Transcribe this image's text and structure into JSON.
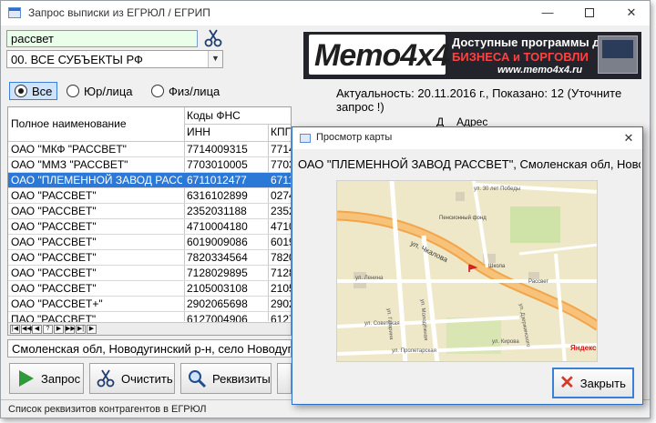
{
  "window": {
    "title": "Запрос выписки из ЕГРЮЛ / ЕГРИП",
    "minimize_glyph": "—",
    "close_glyph": "✕"
  },
  "search": {
    "value": "рассвет"
  },
  "region": {
    "selected": "00. ВСЕ СУБЪЕКТЫ РФ",
    "arrow": "▼"
  },
  "banner": {
    "logo": "Memo4x4",
    "line1": "Доступные программы для",
    "line2": "БИЗНЕСА и ТОРГОВЛИ",
    "line3": "www.memo4x4.ru"
  },
  "filters": {
    "all": "Все",
    "ur": "Юр/лица",
    "fiz": "Физ/лица"
  },
  "status": "Актуальность: 20.11.2016 г., Показано: 12 (Уточните запрос !)",
  "grid": {
    "col_name": "Полное наименование",
    "col_fns": "Коды ФНС",
    "col_inn": "ИНН",
    "col_kpp": "КПП",
    "col_d": "Д",
    "col_addr": "Адрес",
    "rows": [
      {
        "name": "ОАО \"МКФ \"РАССВЕТ\"",
        "inn": "7714009315",
        "kpp": "7714"
      },
      {
        "name": "ОАО \"ММЗ \"РАССВЕТ\"",
        "inn": "7703010005",
        "kpp": "7703"
      },
      {
        "name": "ОАО \"ПЛЕМЕННОЙ ЗАВОД РАСС",
        "inn": "6711012477",
        "kpp": "6711"
      },
      {
        "name": "ОАО \"РАССВЕТ\"",
        "inn": "6316102899",
        "kpp": "0274"
      },
      {
        "name": "ОАО \"РАССВЕТ\"",
        "inn": "2352031188",
        "kpp": "2352"
      },
      {
        "name": "ОАО \"РАССВЕТ\"",
        "inn": "4710004180",
        "kpp": "4710"
      },
      {
        "name": "ОАО \"РАССВЕТ\"",
        "inn": "6019009086",
        "kpp": "6019"
      },
      {
        "name": "ОАО \"РАССВЕТ\"",
        "inn": "7820334564",
        "kpp": "7820"
      },
      {
        "name": "ОАО \"РАССВЕТ\"",
        "inn": "7128029895",
        "kpp": "7128"
      },
      {
        "name": "ОАО \"РАССВЕТ\"",
        "inn": "2105003108",
        "kpp": "2105"
      },
      {
        "name": "ОАО \"РАССВЕТ+\"",
        "inn": "2902065698",
        "kpp": "2902"
      },
      {
        "name": "ПАО \"РАССВЕТ\"",
        "inn": "6127004906",
        "kpp": "6127"
      }
    ],
    "selected_index": 2,
    "nav": [
      "|◀",
      "◀◀",
      "◀",
      "?",
      "▶",
      "▶▶",
      "▶|",
      "▶"
    ]
  },
  "address": "Смоленская обл, Новодугинский р-н, село Новодугино, ул",
  "buttons": {
    "query": "Запрос",
    "clear": "Очистить",
    "requisites": "Реквизиты"
  },
  "statusbar": "Список реквизитов контрагентов в ЕГРЮЛ",
  "dialog": {
    "title": "Просмотр карты",
    "close_glyph": "✕",
    "firm": "ОАО \"ПЛЕМЕННОЙ ЗАВОД РАССВЕТ\", Смоленская обл, Новодугинский",
    "close_button": "Закрыть",
    "close_x": "✕",
    "map": {
      "road_main": "ул. Чкалова",
      "road_a": "ул. Молодёжная",
      "road_b": "ул. Гагарина",
      "road_c": "ул. Ленина",
      "road_d": "ул. Советская",
      "road_e": "ул. Пролетарская",
      "road_f": "ул. Дзержинского",
      "road_g": "ул. Кирова",
      "road_h": "ул. 30 лет Победы",
      "poi1": "Пенсионный фонд",
      "poi2": "Рассвет",
      "poi3": "Школа",
      "brand": "Яндекс"
    }
  }
}
